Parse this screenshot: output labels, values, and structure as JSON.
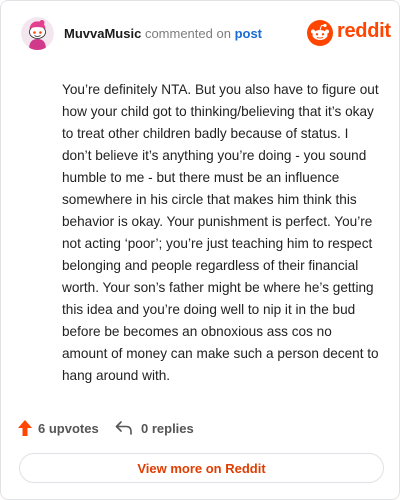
{
  "comment": {
    "username": "MuvvaMusic",
    "verb": "commented on",
    "target_link": "post",
    "body": "You’re definitely NTA. But you also have to figure out how your child got to thinking/believing that it’s okay to treat other children badly because of status. I don’t believe it’s anything you’re doing - you sound humble to me - but there must be an influence somewhere in his circle that makes him think this behavior is okay. Your punishment is perfect. You’re not acting ‘poor’; you’re just teaching him to respect belonging and people regardless of their financial worth. Your son’s father might be where he’s getting this idea and you’re doing well to nip it in the bud before be becomes an obnoxious ass cos no amount of money can make such a person decent to hang around with.",
    "upvotes": "6 upvotes",
    "replies": "0 replies"
  },
  "brand": {
    "name": "reddit",
    "color": "#ff4500"
  },
  "footer": {
    "view_more_label": "View more on Reddit"
  },
  "icons": {
    "avatar": "snoo-avatar-icon",
    "brand": "reddit-logo-icon",
    "upvote": "upvote-arrow-icon",
    "reply": "reply-arrow-icon"
  }
}
